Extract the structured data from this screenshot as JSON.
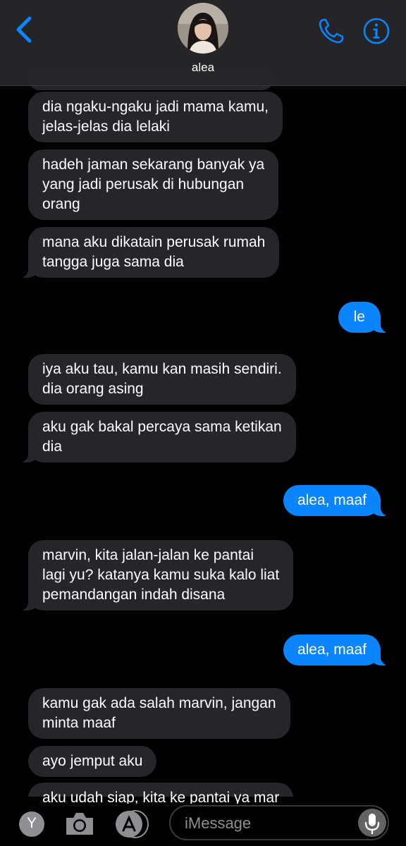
{
  "header": {
    "contact_name": "alea",
    "back_icon": "chevron-left-icon",
    "call_icon": "phone-icon",
    "info_icon": "info-icon",
    "accent": "#0a84ff"
  },
  "messages": [
    {
      "side": "in",
      "lines": [
        "dia ngaku-ngaku jadi mama kamu,",
        "jelas-jelas dia lelaki"
      ]
    },
    {
      "side": "in",
      "lines": [
        "hadeh jaman sekarang banyak ya",
        "yang jadi perusak di hubungan",
        "orang"
      ]
    },
    {
      "side": "in",
      "lines": [
        "mana aku dikatain perusak rumah",
        "tangga juga sama dia"
      ]
    },
    {
      "side": "out",
      "lines": [
        "le"
      ]
    },
    {
      "side": "in",
      "lines": [
        "iya aku tau, kamu kan masih sendiri.",
        "dia orang asing"
      ]
    },
    {
      "side": "in",
      "lines": [
        "aku gak bakal percaya sama ketikan",
        "dia"
      ]
    },
    {
      "side": "out",
      "lines": [
        "alea, maaf"
      ]
    },
    {
      "side": "in",
      "lines": [
        "marvin, kita jalan-jalan ke pantai",
        "lagi yu? katanya kamu suka kalo liat",
        "pemandangan indah disana"
      ]
    },
    {
      "side": "out",
      "lines": [
        "alea, maaf"
      ]
    },
    {
      "side": "in",
      "lines": [
        "kamu gak ada salah marvin, jangan",
        "minta maaf"
      ]
    },
    {
      "side": "in",
      "lines": [
        "ayo jemput aku"
      ]
    },
    {
      "side": "in",
      "lines": [
        "aku udah siap, kita ke pantai ya mar"
      ]
    }
  ],
  "input_bar": {
    "app_store_icon": "app-store-icon",
    "camera_icon": "camera-icon",
    "memoji_label": "Y",
    "placeholder": "iMessage",
    "mic_icon": "microphone-icon"
  },
  "colors": {
    "incoming_bubble": "#26252a",
    "outgoing_bubble": "#0a84ff",
    "background": "#000000"
  }
}
